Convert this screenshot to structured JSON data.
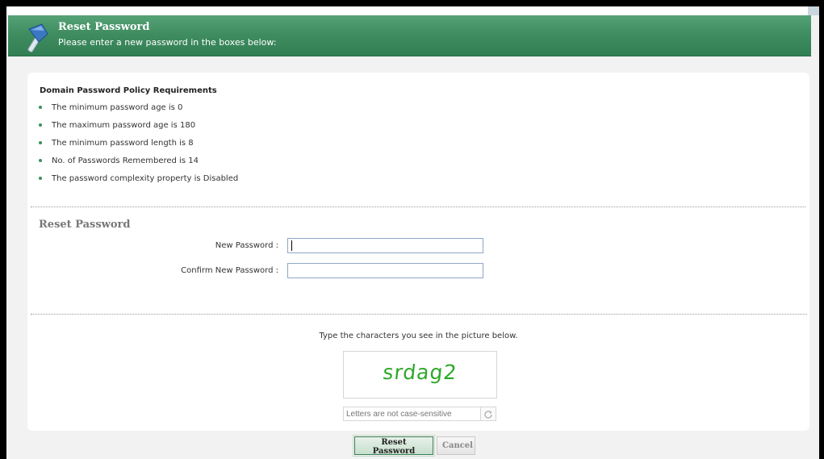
{
  "header": {
    "title": "Reset Password",
    "subtitle": "Please enter a new password in the boxes below:"
  },
  "policy": {
    "title": "Domain Password Policy Requirements",
    "items": [
      "The minimum password age is 0",
      "The maximum password age is 180",
      "The minimum password length is 8",
      "No. of Passwords Remembered is 14",
      "The password complexity property is Disabled"
    ]
  },
  "form": {
    "section_title": "Reset Password",
    "new_password_label": "New Password :",
    "new_password_value": "",
    "confirm_password_label": "Confirm New Password :",
    "confirm_password_value": ""
  },
  "captcha": {
    "instruction": "Type the characters you see in the picture below.",
    "image_text": "srdag2",
    "input_placeholder": "Letters are not case-sensitive"
  },
  "buttons": {
    "reset_label": "Reset Password",
    "cancel_label": "Cancel"
  },
  "colors": {
    "header_green": "#3f8c60",
    "captcha_green": "#2ea82a",
    "bullet_green": "#3a8e60"
  },
  "icons": {
    "header": "key-icon",
    "captcha_refresh": "refresh-icon"
  }
}
